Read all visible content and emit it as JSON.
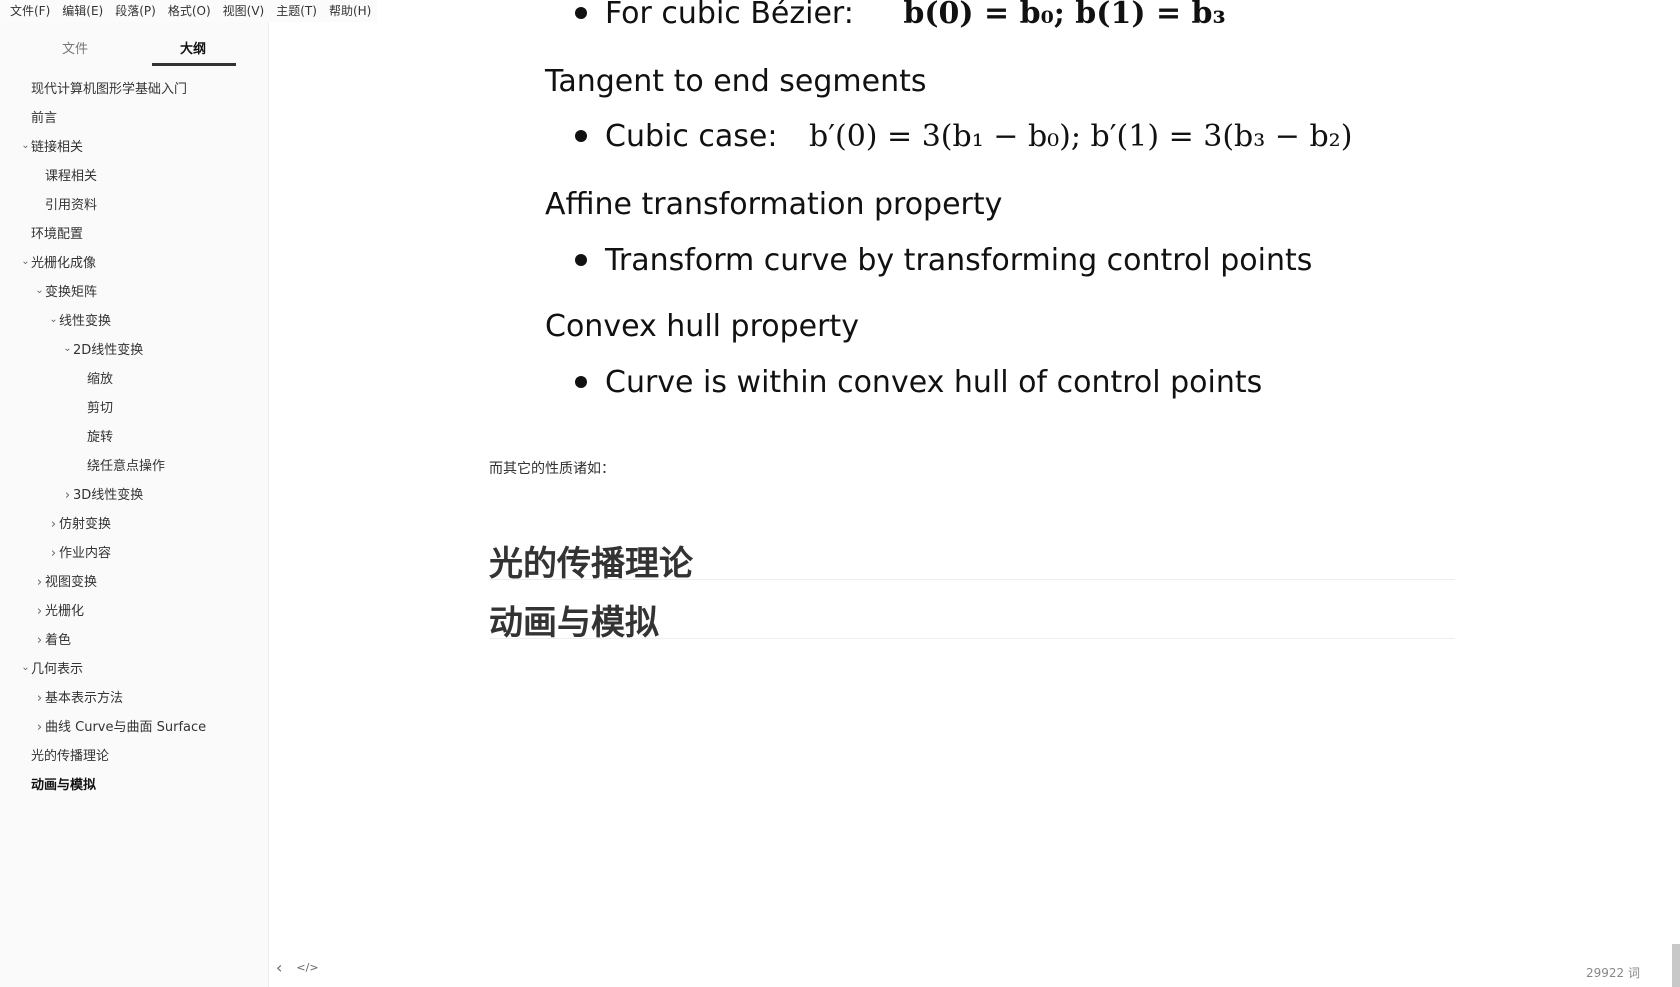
{
  "menubar": [
    "文件(F)",
    "编辑(E)",
    "段落(P)",
    "格式(O)",
    "视图(V)",
    "主题(T)",
    "帮助(H)"
  ],
  "sidebar": {
    "tabs": [
      "文件",
      "大纲"
    ],
    "items": [
      {
        "label": "现代计算机图形学基础入门",
        "level": 0,
        "caret": ""
      },
      {
        "label": "前言",
        "level": 0,
        "caret": ""
      },
      {
        "label": "链接相关",
        "level": 0,
        "caret": "down"
      },
      {
        "label": "课程相关",
        "level": 1,
        "caret": ""
      },
      {
        "label": "引用资料",
        "level": 1,
        "caret": ""
      },
      {
        "label": "环境配置",
        "level": 0,
        "caret": ""
      },
      {
        "label": "光栅化成像",
        "level": 0,
        "caret": "down"
      },
      {
        "label": "变换矩阵",
        "level": 1,
        "caret": "down"
      },
      {
        "label": "线性变换",
        "level": 2,
        "caret": "down"
      },
      {
        "label": "2D线性变换",
        "level": 3,
        "caret": "down"
      },
      {
        "label": "缩放",
        "level": 4,
        "caret": ""
      },
      {
        "label": "剪切",
        "level": 4,
        "caret": ""
      },
      {
        "label": "旋转",
        "level": 4,
        "caret": ""
      },
      {
        "label": "绕任意点操作",
        "level": 4,
        "caret": ""
      },
      {
        "label": "3D线性变换",
        "level": 3,
        "caret": "right"
      },
      {
        "label": "仿射变换",
        "level": 2,
        "caret": "right"
      },
      {
        "label": "作业内容",
        "level": 2,
        "caret": "right"
      },
      {
        "label": "视图变换",
        "level": 1,
        "caret": "right"
      },
      {
        "label": "光栅化",
        "level": 1,
        "caret": "right"
      },
      {
        "label": "着色",
        "level": 1,
        "caret": "right"
      },
      {
        "label": "几何表示",
        "level": 0,
        "caret": "down"
      },
      {
        "label": "基本表示方法",
        "level": 1,
        "caret": "right"
      },
      {
        "label": "曲线 Curve与曲面 Surface",
        "level": 1,
        "caret": "right"
      },
      {
        "label": "光的传播理论",
        "level": 0,
        "caret": ""
      },
      {
        "label": "动画与模拟",
        "level": 0,
        "caret": "",
        "active": true
      }
    ]
  },
  "slide": {
    "top_line_text": "For cubic Bézier:",
    "top_line_math": "b(0) = b₀;  b(1) = b₃",
    "heading1": "Tangent to end segments",
    "bullet1_text": "Cubic case:",
    "bullet1_math": "b′(0) = 3(b₁ − b₀);  b′(1) = 3(b₃ − b₂)",
    "heading2": "Affine transformation property",
    "bullet2": "Transform curve by transforming control points",
    "heading3": "Convex hull property",
    "bullet3": "Curve is within convex hull of control points"
  },
  "content": {
    "paragraph": "而其它的性质诸如：",
    "h1_light": "光的传播理论",
    "h1_anim": "动画与模拟"
  },
  "footer": {
    "back_icon": "‹",
    "source_icon": "</>",
    "word_count": "29922 词"
  }
}
